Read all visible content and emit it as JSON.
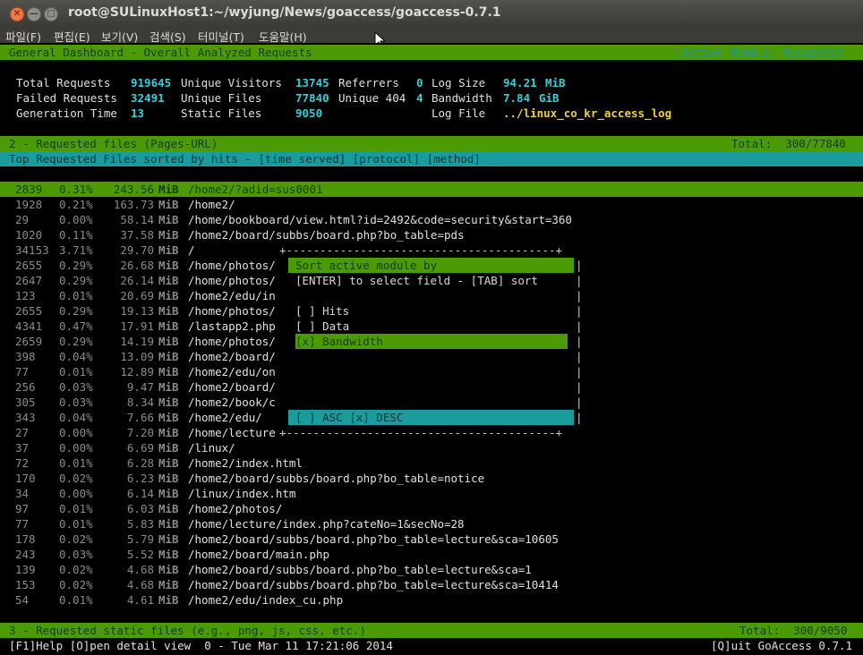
{
  "window": {
    "title": "root@SULinuxHost1:~/wyjung/News/goaccess/goaccess-0.7.1",
    "close_glyph": "✕",
    "min_glyph": "—",
    "max_glyph": "□"
  },
  "menubar": [
    "파일(F)",
    "편집(E)",
    "보기(V)",
    "검색(S)",
    "터미널(T)",
    "도움말(H)"
  ],
  "header": {
    "title": "General Dashboard - Overall Analyzed Requests",
    "active_module": "[Active Module: Requests]"
  },
  "stats": {
    "total_requests_label": "Total Requests",
    "total_requests": "919645",
    "unique_visitors_label": "Unique Visitors",
    "unique_visitors": "13745",
    "referrers_label": "Referrers",
    "referrers": "0",
    "log_size_label": "Log Size",
    "log_size": "94.21",
    "log_size_unit": "MiB",
    "failed_requests_label": "Failed Requests",
    "failed_requests": "32491",
    "unique_files_label": "Unique Files",
    "unique_files": "77840",
    "unique404_label": "Unique 404",
    "unique404": "4",
    "bandwidth_label": "Bandwidth",
    "bandwidth": "7.84",
    "bandwidth_unit": "GiB",
    "generation_time_label": "Generation Time",
    "generation_time": "13",
    "static_files_label": "Static Files",
    "static_files": "9050",
    "log_file_label": "Log File",
    "log_file": "../linux_co_kr_access_log"
  },
  "module2": {
    "title": "2 - Requested files (Pages-URL)",
    "total": "Total:  300/77840",
    "subtitle": "Top Requested Files sorted by hits - [time served] [protocol] [method]"
  },
  "rows": [
    {
      "hits": "2839",
      "pct": "0.31%",
      "bw": "243.56",
      "unit": "MiB",
      "path": "/home2/?adid=sus0001"
    },
    {
      "hits": "1928",
      "pct": "0.21%",
      "bw": "163.73",
      "unit": "MiB",
      "path": "/home2/"
    },
    {
      "hits": "29",
      "pct": "0.00%",
      "bw": "58.14",
      "unit": "MiB",
      "path": "/home/bookboard/view.html?id=2492&code=security&start=360"
    },
    {
      "hits": "1020",
      "pct": "0.11%",
      "bw": "37.58",
      "unit": "MiB",
      "path": "/home2/board/subbs/board.php?bo_table=pds"
    },
    {
      "hits": "34153",
      "pct": "3.71%",
      "bw": "29.70",
      "unit": "MiB",
      "path": "/"
    },
    {
      "hits": "2655",
      "pct": "0.29%",
      "bw": "26.68",
      "unit": "MiB",
      "path": "/home/photos/"
    },
    {
      "hits": "2647",
      "pct": "0.29%",
      "bw": "26.14",
      "unit": "MiB",
      "path": "/home/photos/"
    },
    {
      "hits": "123",
      "pct": "0.01%",
      "bw": "20.69",
      "unit": "MiB",
      "path": "/home2/edu/in"
    },
    {
      "hits": "2655",
      "pct": "0.29%",
      "bw": "19.13",
      "unit": "MiB",
      "path": "/home/photos/"
    },
    {
      "hits": "4341",
      "pct": "0.47%",
      "bw": "17.91",
      "unit": "MiB",
      "path": "/lastapp2.php"
    },
    {
      "hits": "2659",
      "pct": "0.29%",
      "bw": "14.19",
      "unit": "MiB",
      "path": "/home/photos/"
    },
    {
      "hits": "398",
      "pct": "0.04%",
      "bw": "13.09",
      "unit": "MiB",
      "path": "/home2/board/"
    },
    {
      "hits": "77",
      "pct": "0.01%",
      "bw": "12.89",
      "unit": "MiB",
      "path": "/home2/edu/on"
    },
    {
      "hits": "256",
      "pct": "0.03%",
      "bw": "9.47",
      "unit": "MiB",
      "path": "/home2/board/"
    },
    {
      "hits": "305",
      "pct": "0.03%",
      "bw": "8.34",
      "unit": "MiB",
      "path": "/home2/book/c"
    },
    {
      "hits": "343",
      "pct": "0.04%",
      "bw": "7.66",
      "unit": "MiB",
      "path": "/home2/edu/"
    },
    {
      "hits": "27",
      "pct": "0.00%",
      "bw": "7.20",
      "unit": "MiB",
      "path": "/home/lecture"
    },
    {
      "hits": "37",
      "pct": "0.00%",
      "bw": "6.69",
      "unit": "MiB",
      "path": "/linux/"
    },
    {
      "hits": "72",
      "pct": "0.01%",
      "bw": "6.28",
      "unit": "MiB",
      "path": "/home2/index.html"
    },
    {
      "hits": "170",
      "pct": "0.02%",
      "bw": "6.23",
      "unit": "MiB",
      "path": "/home2/board/subbs/board.php?bo_table=notice"
    },
    {
      "hits": "34",
      "pct": "0.00%",
      "bw": "6.14",
      "unit": "MiB",
      "path": "/linux/index.htm"
    },
    {
      "hits": "97",
      "pct": "0.01%",
      "bw": "6.03",
      "unit": "MiB",
      "path": "/home2/photos/"
    },
    {
      "hits": "77",
      "pct": "0.01%",
      "bw": "5.83",
      "unit": "MiB",
      "path": "/home/lecture/index.php?cateNo=1&secNo=28"
    },
    {
      "hits": "178",
      "pct": "0.02%",
      "bw": "5.79",
      "unit": "MiB",
      "path": "/home2/board/subbs/board.php?bo_table=lecture&sca=10605"
    },
    {
      "hits": "243",
      "pct": "0.03%",
      "bw": "5.52",
      "unit": "MiB",
      "path": "/home2/board/main.php"
    },
    {
      "hits": "139",
      "pct": "0.02%",
      "bw": "4.68",
      "unit": "MiB",
      "path": "/home2/board/subbs/board.php?bo_table=lecture&sca=1"
    },
    {
      "hits": "153",
      "pct": "0.02%",
      "bw": "4.68",
      "unit": "MiB",
      "path": "/home2/board/subbs/board.php?bo_table=lecture&sca=10414"
    },
    {
      "hits": "54",
      "pct": "0.01%",
      "bw": "4.61",
      "unit": "MiB",
      "path": "/home2/edu/index_cu.php"
    }
  ],
  "sort_dialog": {
    "border_top": "+----------------------------------------+",
    "border_bottom": "+----------------------------------------+",
    "title": "Sort active module by",
    "hint": "[ENTER] to select field - [TAB] sort",
    "option_hits": "[ ] Hits",
    "option_data": "[ ] Data",
    "option_bandwidth": "[x] Bandwidth",
    "order": "[ ] ASC [x] DESC"
  },
  "module3": {
    "title": "3 - Requested static files (e.g., png, js, css, etc.)",
    "total": "Total:  300/9050"
  },
  "footer": {
    "left": "[F1]Help [O]pen detail view  0 - Tue Mar 11 17:21:06 2014",
    "right": "[Q]uit GoAccess 0.7.1"
  }
}
